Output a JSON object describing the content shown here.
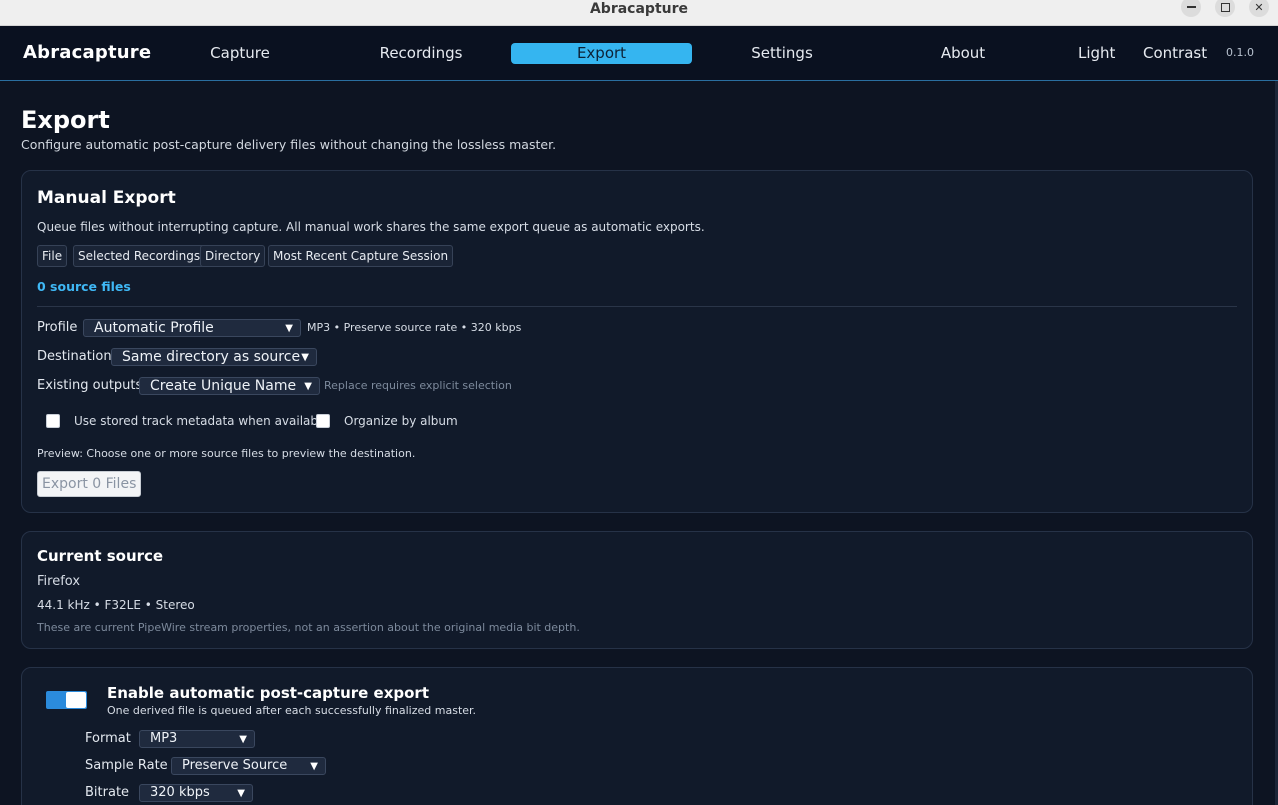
{
  "window": {
    "title": "Abracapture"
  },
  "nav": {
    "brand": "Abracapture",
    "tabs": [
      "Capture",
      "Recordings",
      "Export",
      "Settings",
      "About"
    ],
    "active_tab": "Export",
    "links": {
      "light": "Light",
      "contrast": "Contrast"
    },
    "version": "0.1.0"
  },
  "page": {
    "title": "Export",
    "subtitle": "Configure automatic post-capture delivery files without changing the lossless master."
  },
  "manual_export": {
    "title": "Manual Export",
    "description": "Queue files without interrupting capture. All manual work shares the same export queue as automatic exports.",
    "source_buttons": [
      "File",
      "Selected Recordings",
      "Directory",
      "Most Recent Capture Session"
    ],
    "source_count": "0 source files",
    "profile_label": "Profile",
    "profile_value": "Automatic Profile",
    "profile_summary": "MP3 • Preserve source rate • 320 kbps",
    "destination_label": "Destination",
    "destination_value": "Same directory as source",
    "existing_label": "Existing outputs",
    "existing_value": "Create Unique Name",
    "existing_hint": "Replace requires explicit selection",
    "metadata_checkbox": "Use stored track metadata when available",
    "metadata_checked": false,
    "album_checkbox": "Organize by album",
    "album_checked": false,
    "preview": "Preview: Choose one or more source files to preview the destination.",
    "export_button": "Export 0 Files"
  },
  "current_source": {
    "title": "Current source",
    "name": "Firefox",
    "properties": "44.1 kHz • F32LE • Stereo",
    "note": "These are current PipeWire stream properties, not an assertion about the original media bit depth."
  },
  "auto_export": {
    "enabled": true,
    "title": "Enable automatic post-capture export",
    "description": "One derived file is queued after each successfully finalized master.",
    "format_label": "Format",
    "format_value": "MP3",
    "sample_rate_label": "Sample Rate",
    "sample_rate_value": "Preserve Source",
    "bitrate_label": "Bitrate",
    "bitrate_value": "320 kbps"
  },
  "colors": {
    "background": "#0d1422",
    "accent": "#35b5f0",
    "toggle_on": "#2b8bdc"
  }
}
